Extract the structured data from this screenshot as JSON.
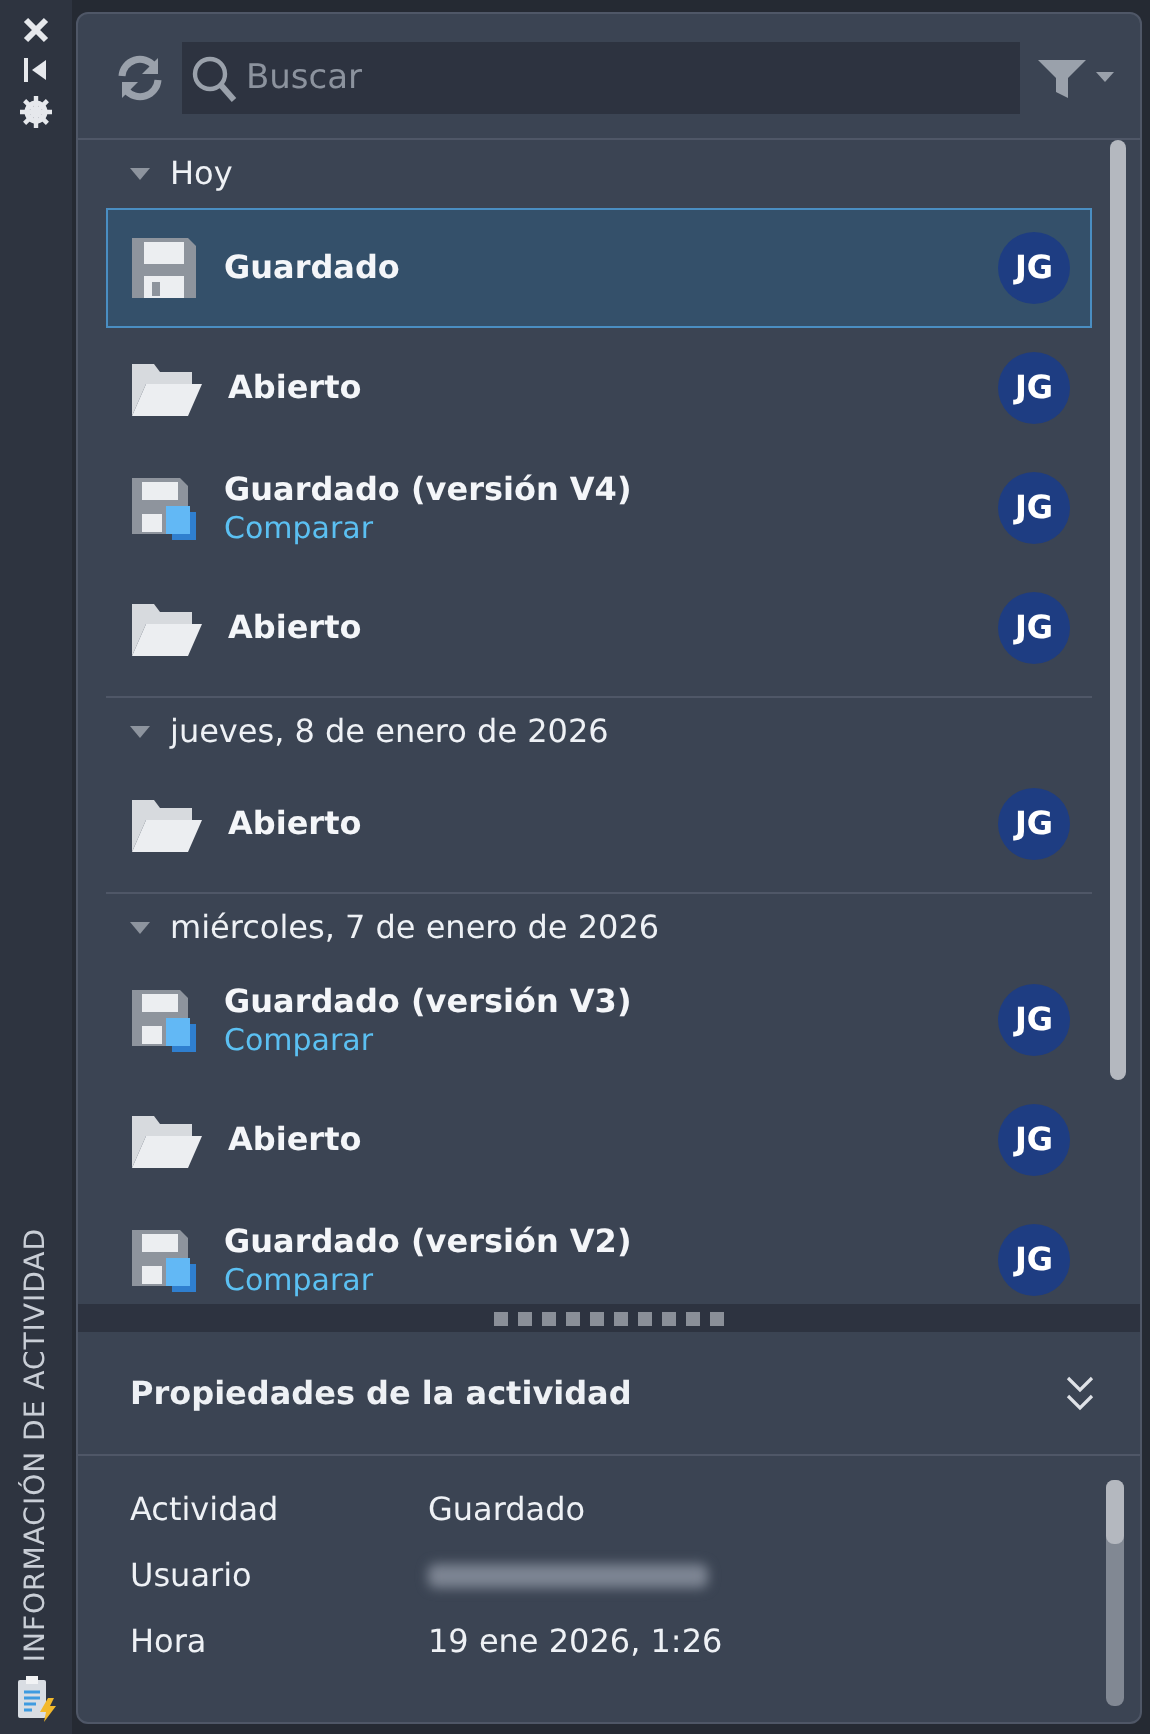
{
  "side_toolbar": {
    "title": "INFORMACIÓN DE ACTIVIDAD"
  },
  "search": {
    "placeholder": "Buscar"
  },
  "groups": [
    {
      "label": "Hoy",
      "expanded": true,
      "items": [
        {
          "kind": "saved",
          "title": "Guardado",
          "user": "JG",
          "selected": true
        },
        {
          "kind": "opened",
          "title": "Abierto",
          "user": "JG",
          "selected": false
        },
        {
          "kind": "version",
          "title": "Guardado (versión V4)",
          "link": "Comparar",
          "user": "JG",
          "selected": false
        },
        {
          "kind": "opened",
          "title": "Abierto",
          "user": "JG",
          "selected": false
        }
      ]
    },
    {
      "label": "jueves, 8 de enero de 2026",
      "expanded": true,
      "items": [
        {
          "kind": "opened",
          "title": "Abierto",
          "user": "JG",
          "selected": false
        }
      ]
    },
    {
      "label": "miércoles, 7 de enero de 2026",
      "expanded": true,
      "items": [
        {
          "kind": "version",
          "title": "Guardado (versión V3)",
          "link": "Comparar",
          "user": "JG",
          "selected": false
        },
        {
          "kind": "opened",
          "title": "Abierto",
          "user": "JG",
          "selected": false
        },
        {
          "kind": "version",
          "title": "Guardado (versión V2)",
          "link": "Comparar",
          "user": "JG",
          "selected": false
        }
      ]
    }
  ],
  "properties": {
    "title": "Propiedades de la actividad",
    "rows": [
      {
        "label": "Actividad",
        "value": "Guardado"
      },
      {
        "label": "Usuario",
        "redacted": true
      },
      {
        "label": "Hora",
        "value": "19 ene 2026, 1:26"
      }
    ]
  }
}
